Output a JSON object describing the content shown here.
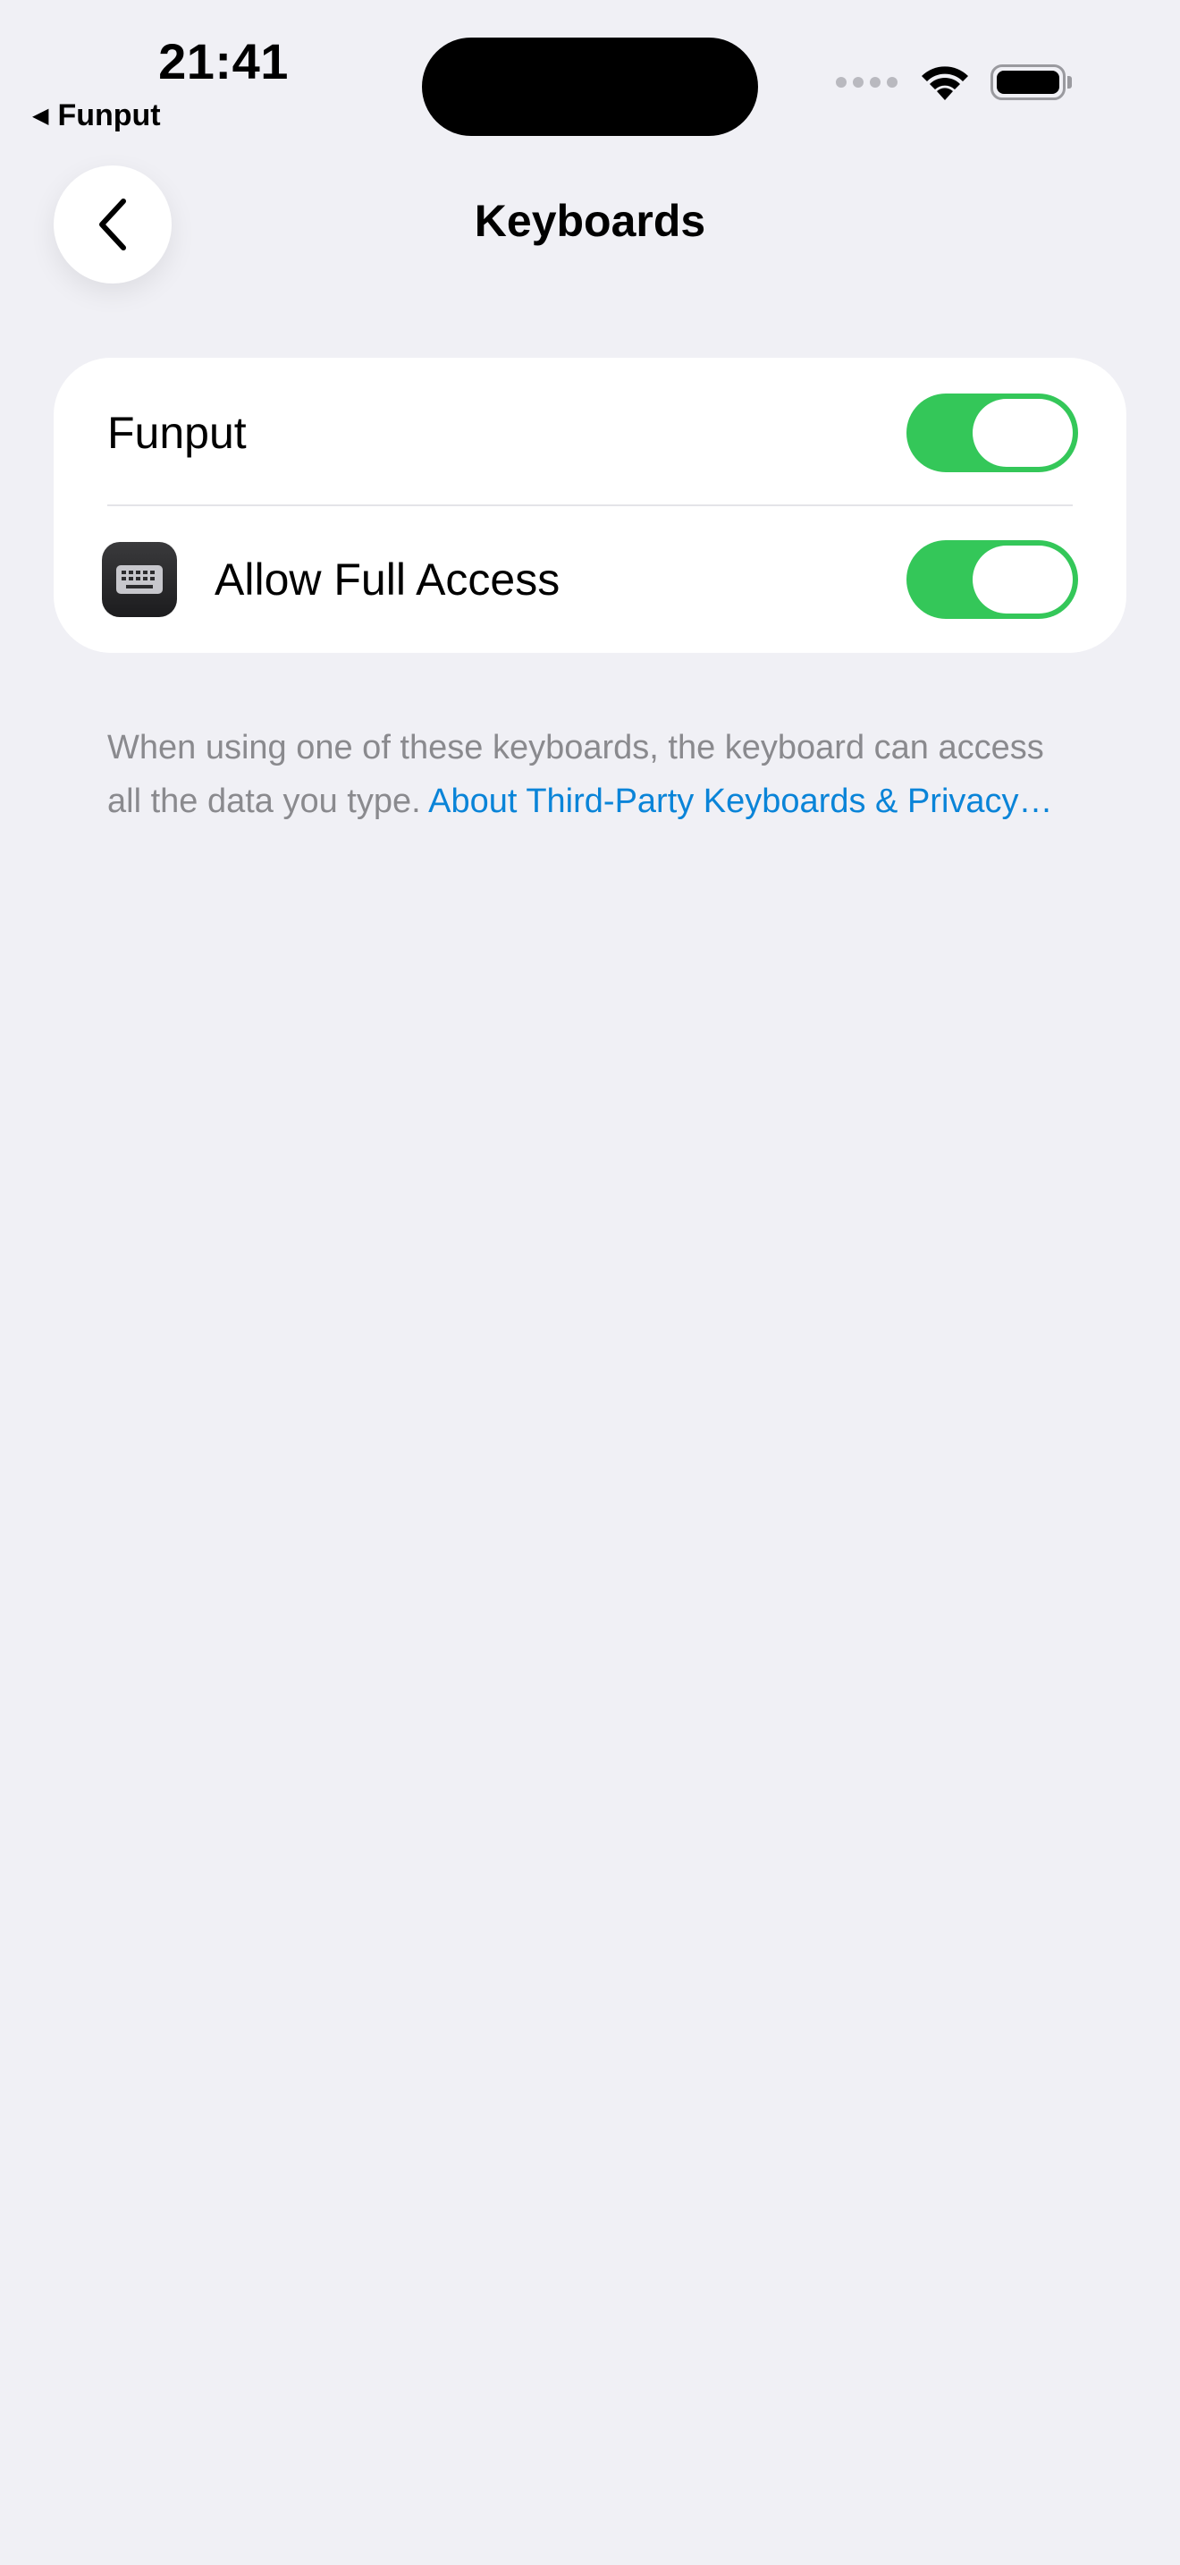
{
  "status_bar": {
    "time": "21:41",
    "back_app": "Funput"
  },
  "nav": {
    "title": "Keyboards"
  },
  "settings": {
    "rows": [
      {
        "label": "Funput",
        "on": true
      },
      {
        "label": "Allow Full Access",
        "on": true
      }
    ]
  },
  "footer": {
    "text": "When using one of these keyboards, the keyboard can access all the data you type. ",
    "link": "About Third-Party Keyboards & Privacy…"
  },
  "colors": {
    "background": "#f0f0f5",
    "toggle_on": "#34c759",
    "link": "#0a84d8"
  }
}
